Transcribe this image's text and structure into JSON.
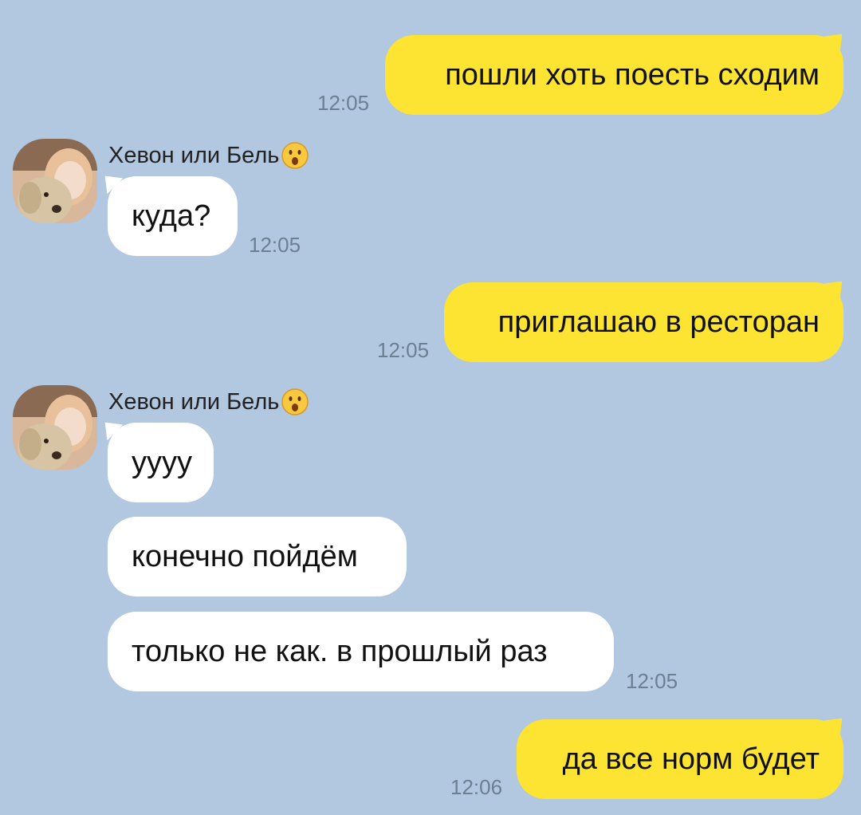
{
  "messages": [
    {
      "id": "m1",
      "direction": "out",
      "text": "пошли хоть поесть сходим",
      "time": "12:05"
    },
    {
      "id": "m2",
      "direction": "in",
      "sender": "Хевон или Бель",
      "sender_emoji": "surprised-face-icon",
      "text": "куда?",
      "time": "12:05"
    },
    {
      "id": "m3",
      "direction": "out",
      "text": "приглашаю в ресторан",
      "time": "12:05"
    },
    {
      "id": "m4",
      "direction": "in",
      "sender": "Хевон или Бель",
      "sender_emoji": "surprised-face-icon",
      "text": "уууу",
      "time": ""
    },
    {
      "id": "m5",
      "direction": "in",
      "text": "конечно пойдём",
      "time": ""
    },
    {
      "id": "m6",
      "direction": "in",
      "text": "только не как. в прошлый раз",
      "time": "12:05"
    },
    {
      "id": "m7",
      "direction": "out",
      "text": "да все норм будет",
      "time": "12:06"
    }
  ],
  "colors": {
    "background": "#b2c7e0",
    "outgoing_bubble": "#fde433",
    "incoming_bubble": "#ffffff",
    "timestamp": "#6c7f93"
  }
}
